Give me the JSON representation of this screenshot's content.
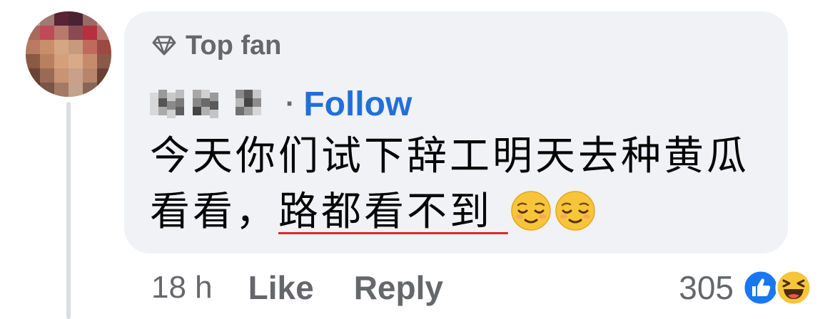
{
  "badge": {
    "icon": "diamond-icon",
    "label": "Top fan"
  },
  "author": {
    "name_obscured": true,
    "separator": "·",
    "follow_label": "Follow"
  },
  "comment": {
    "line1": "今天你们试下辞工明天去种黄瓜",
    "line2_plain": "看看，",
    "line2_underlined": "路都看不到",
    "emojis": [
      "relieved-face-emoji",
      "relieved-face-emoji"
    ]
  },
  "actions": {
    "timestamp": "18 h",
    "like_label": "Like",
    "reply_label": "Reply"
  },
  "reactions": {
    "count": "305",
    "icons": [
      "like-reaction-icon",
      "haha-reaction-icon"
    ]
  },
  "colors": {
    "bubble_bg": "#f0f2f5",
    "follow": "#216fdb",
    "secondary_text": "#65676b",
    "underline": "#e0242a"
  }
}
